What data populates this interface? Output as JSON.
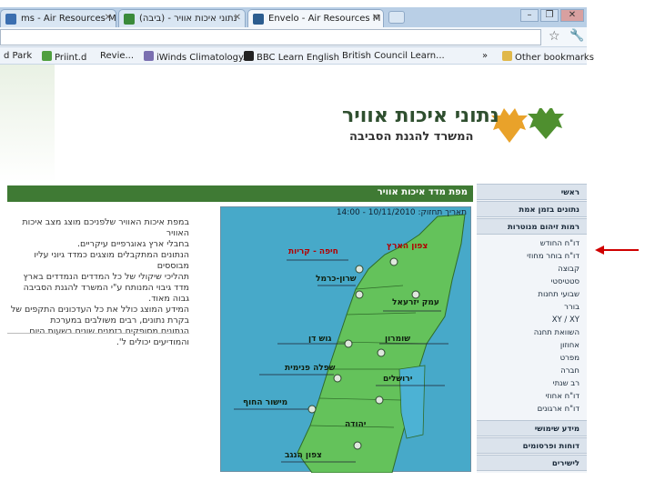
{
  "browser": {
    "tabs": [
      {
        "title": "ms - Air Resources M",
        "active": false,
        "icon_color": "#3b6fb0"
      },
      {
        "title": "נתוני איכות אוויר - (ביבה)",
        "active": false,
        "icon_color": "#3a8a3a"
      },
      {
        "title": "Envelo - Air Resources M",
        "active": true,
        "icon_color": "#2c5d8f"
      }
    ],
    "window_controls": [
      "minimize",
      "restore",
      "close"
    ],
    "bookmarks": [
      {
        "label": "d Park",
        "icon": "none"
      },
      {
        "label": "Priint.d",
        "icon": "green-box-icon"
      },
      {
        "label": "Revie...",
        "icon": "none"
      },
      {
        "label": "iWinds Climatology...",
        "icon": "map-icon"
      },
      {
        "label": "BBC Learn English",
        "icon": "bbc-icon"
      },
      {
        "label": "British Council Learn...",
        "icon": "none"
      },
      {
        "label": "Other bookmarks",
        "icon": "folder-icon"
      }
    ],
    "overflow_marker": "»"
  },
  "site": {
    "title": "נתוני איכות אוויר",
    "subtitle": "המשרד להגנת הסביבה",
    "leaf_colors": [
      "#e9a22a",
      "#4f8f2f"
    ]
  },
  "content": {
    "section_title": "מפת מדד איכות אוויר",
    "paragraphs": [
      "במפת איכות האוויר שלפניכם מוצג מצב איכות האוויר",
      "בחבלי ארץ גאוגרפיים עיקריים.",
      "הנתונים המתקבלים מוצגים כמדד גיוני עליו מבוססים",
      "תהליכי שיקולי של כל המדדים הנמדדים בארץ",
      "מדד גיבוי המנותח ע\"י המשרד להגנת הסביבה",
      "גבוה מאוד.",
      "המידע המוצג כולל את כל העדכונים התקפים של",
      "בקרת נתונים, רבים משולבים במערכת",
      "הנתונים מסופקים בזמנים שונים בשעות היום",
      "והמודיעים יכולים ל'."
    ]
  },
  "map": {
    "header": "תאריך תחזוק: 10/11/2010 - 14:00",
    "sea_color": "#47a9c9",
    "land_color": "#64c25b",
    "regions": [
      {
        "name": "צפון הארץ",
        "red": true
      },
      {
        "name": "חיפה - קריות",
        "red": true
      },
      {
        "name": "שרון-כרמל",
        "red": false
      },
      {
        "name": "עמק יזרעאל",
        "red": false
      },
      {
        "name": "גוש דן",
        "red": false
      },
      {
        "name": "שומרון",
        "red": false
      },
      {
        "name": "שפלה פנימית",
        "red": false
      },
      {
        "name": "ירושלים",
        "red": false
      },
      {
        "name": "מישור החוף",
        "red": false
      },
      {
        "name": "יהודה",
        "red": false
      },
      {
        "name": "צפון הנגב",
        "red": false
      }
    ]
  },
  "sidebar": {
    "items": [
      {
        "label": "ראשי",
        "type": "hdr"
      },
      {
        "label": "נתונים בזמן אמת",
        "type": "hdr"
      },
      {
        "label": "רמות זיהום מנוטרות",
        "type": "hdr"
      },
      {
        "label": "דו\"ח החודש",
        "type": "sub"
      },
      {
        "label": "דו\"ח בוחר מחוזי",
        "type": "sub"
      },
      {
        "label": "קבוצה",
        "type": "sub"
      },
      {
        "label": "סטטיסטי",
        "type": "sub"
      },
      {
        "label": "שבועי תחנות",
        "type": "sub"
      },
      {
        "label": "בורר",
        "type": "sub"
      },
      {
        "label": "XY / XY",
        "type": "sub"
      },
      {
        "label": "השוואת תחנה",
        "type": "sub"
      },
      {
        "label": "אחוזון",
        "type": "sub"
      },
      {
        "label": "מפרט",
        "type": "sub"
      },
      {
        "label": "חברה",
        "type": "sub"
      },
      {
        "label": "רב שנתי",
        "type": "sub"
      },
      {
        "label": "דו\"ח אחוזי",
        "type": "sub"
      },
      {
        "label": "דו\"ח ארגונים",
        "type": "sub"
      },
      {
        "label": "מידע שימושי",
        "type": "hdr"
      },
      {
        "label": "דוחות ופרסומים",
        "type": "hdr"
      },
      {
        "label": "לישירים",
        "type": "hdr"
      }
    ]
  },
  "annotation": {
    "arrow_color": "#d00000"
  }
}
